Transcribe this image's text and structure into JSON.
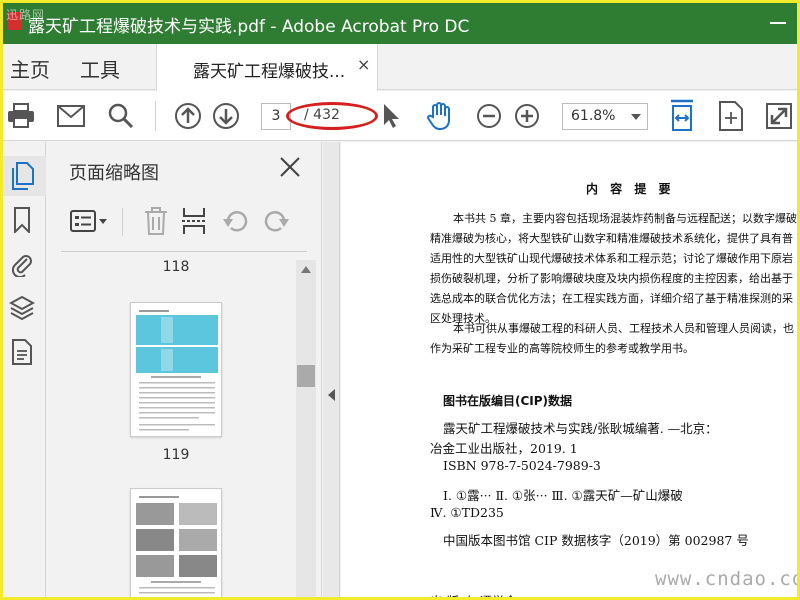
{
  "window": {
    "title": "露天矿工程爆破技术与实践.pdf - Adobe Acrobat Pro DC",
    "watermark_logo": "迅路网"
  },
  "nav": {
    "home": "主页",
    "tools": "工具"
  },
  "tab": {
    "label": "露天矿工程爆破技...",
    "close": "×"
  },
  "toolbar": {
    "current_page": "3",
    "total_pages": "/ 432",
    "zoom": "61.8%"
  },
  "panel": {
    "title": "页面缩略图",
    "pages": [
      {
        "number": "118"
      },
      {
        "number": "119"
      }
    ]
  },
  "document": {
    "heading": "内 容 提 要",
    "summary_lines": [
      "本书共 5 章，主要内容包括现场混装炸药制备与远程配送；以数字爆破",
      "精准爆破为核心，将大型铁矿山数字和精准爆破技术系统化，提供了具有普",
      "适用性的大型铁矿山现代爆破技术体系和工程示范；讨论了爆破作用下原岩",
      "损伤破裂机理，分析了影响爆破块度及块内损伤程度的主控因素，给出基于",
      "选总成本的联合优化方法；在工程实践方面，详细介绍了基于精准探测的采",
      "区处理技术。",
      "本书可供从事爆破工程的科研人员、工程技术人员和管理人员阅读，也",
      "作为采矿工程专业的高等院校师生的参考或教学用书。"
    ],
    "cip_title": "图书在版编目(CIP)数据",
    "cip_lines": [
      "露天矿工程爆破技术与实践/张耿城编著. —北京：",
      "冶金工业出版社，2019. 1",
      "ISBN 978-7-5024-7989-3",
      "Ⅰ. ①露···   Ⅱ. ①张···   Ⅲ. ①露天矿—矿山爆破",
      "Ⅳ. ①TD235",
      "中国版本图书馆 CIP 数据核字（2019）第 002987 号",
      "出 版 人   谭学余"
    ],
    "site_watermark": "www.cndao.com"
  },
  "colors": {
    "titlebar": "#2e7d32",
    "tool_blue": "#1a73c7",
    "annotation_red": "#d62020",
    "frame_yellow": "#f2ea2a"
  }
}
